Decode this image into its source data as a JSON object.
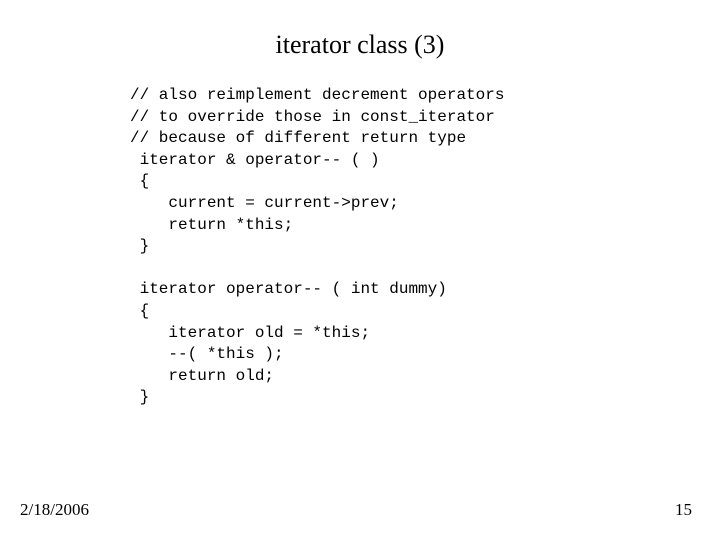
{
  "slide": {
    "title": "iterator class (3)",
    "code": "// also reimplement decrement operators\n// to override those in const_iterator\n// because of different return type\n iterator & operator-- ( )\n {\n    current = current->prev;\n    return *this;\n }\n\n iterator operator-- ( int dummy)\n {\n    iterator old = *this;\n    --( *this );\n    return old;\n }",
    "footer": {
      "date": "2/18/2006",
      "page": "15"
    }
  }
}
